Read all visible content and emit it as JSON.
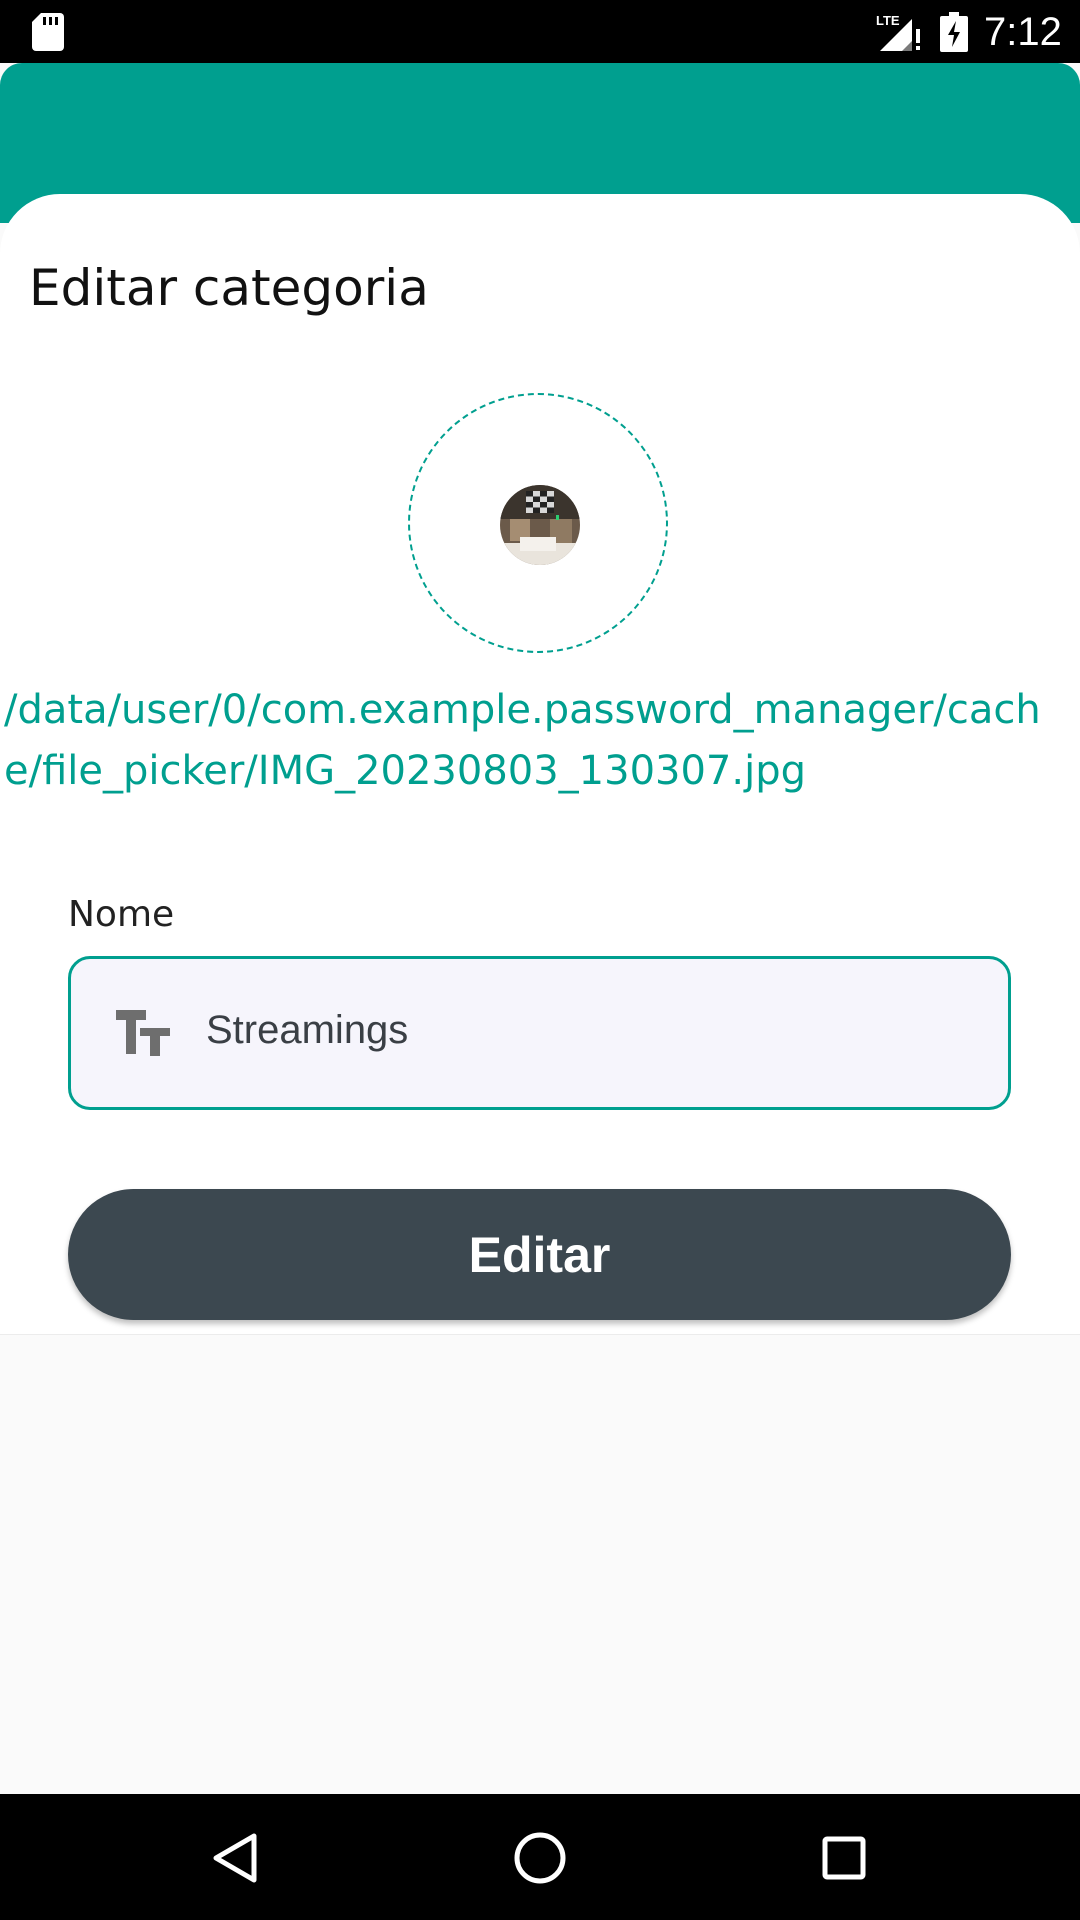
{
  "status_bar": {
    "time": "7:12",
    "network_label": "LTE",
    "icons": [
      "sd-card-icon",
      "signal-icon",
      "battery-charging-icon"
    ]
  },
  "sheet": {
    "title": "Editar categoria",
    "image_path": "/data/user/0/com.example.password_manager/cache/file_picker/IMG_20230803_130307.jpg"
  },
  "form": {
    "name_label": "Nome",
    "name_value": "Streamings",
    "name_icon": "text-size-icon",
    "submit_label": "Editar"
  },
  "nav_bar": {
    "icons": [
      "back-icon",
      "home-icon",
      "recents-icon"
    ]
  },
  "colors": {
    "accent": "#009f8f",
    "button": "#3c4850",
    "field_background": "#f6f5fc",
    "page_background": "#fafafa"
  }
}
